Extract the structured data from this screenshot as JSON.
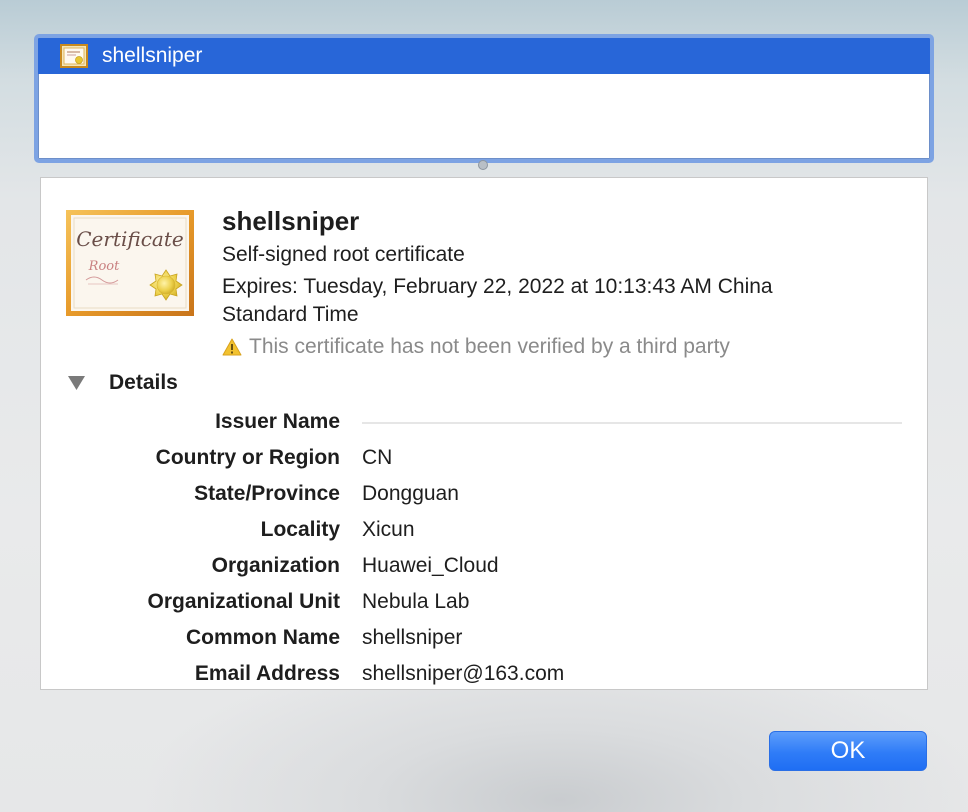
{
  "certificate_list": {
    "selected_item": "shellsniper"
  },
  "summary": {
    "title": "shellsniper",
    "kind": "Self-signed root certificate",
    "expires_line1": "Expires: Tuesday, February 22, 2022 at 10:13:43 AM China",
    "expires_line2": "Standard Time",
    "warning": "This certificate has not been verified by a third party"
  },
  "certificate_image": {
    "title_text": "Certificate",
    "subtitle_text": "Root"
  },
  "details": {
    "label": "Details",
    "section_title": "Issuer Name",
    "fields": [
      {
        "label": "Country or Region",
        "value": "CN"
      },
      {
        "label": "State/Province",
        "value": "Dongguan"
      },
      {
        "label": "Locality",
        "value": "Xicun"
      },
      {
        "label": "Organization",
        "value": "Huawei_Cloud"
      },
      {
        "label": "Organizational Unit",
        "value": "Nebula Lab"
      },
      {
        "label": "Common Name",
        "value": "shellsniper"
      },
      {
        "label": "Email Address",
        "value": "shellsniper@163.com"
      }
    ]
  },
  "buttons": {
    "ok_label": "OK"
  },
  "colors": {
    "selection": "#2866d8",
    "focus_ring": "#7da3e3",
    "button_blue": "#2f7cf7",
    "warning_text": "#8a8a8a",
    "seal_gold": "#e8c833"
  },
  "icons": {
    "list_item": "certificate-icon",
    "warning": "warning-triangle-icon",
    "disclosure": "disclosure-triangle-down-icon"
  }
}
